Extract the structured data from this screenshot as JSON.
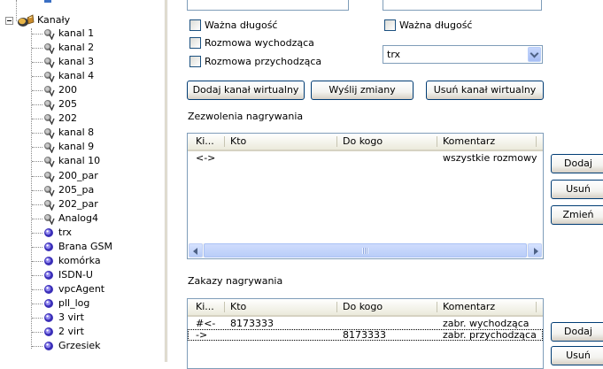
{
  "tree": {
    "partial_top_label": "",
    "root_label": "Kanały",
    "items": [
      {
        "label": "kanal 1",
        "icon": "channel-v-icon"
      },
      {
        "label": "kanal 2",
        "icon": "channel-v-icon"
      },
      {
        "label": "kanal 3",
        "icon": "channel-v-icon"
      },
      {
        "label": "kanal 4",
        "icon": "channel-v-icon"
      },
      {
        "label": "200",
        "icon": "channel-v-icon"
      },
      {
        "label": "205",
        "icon": "channel-v-icon"
      },
      {
        "label": "202",
        "icon": "channel-v-icon"
      },
      {
        "label": "kanal 8",
        "icon": "channel-v-icon"
      },
      {
        "label": "kanal 9",
        "icon": "channel-v-icon"
      },
      {
        "label": "kanal 10",
        "icon": "channel-v-icon"
      },
      {
        "label": "200_par",
        "icon": "channel-v-icon"
      },
      {
        "label": "205_pa",
        "icon": "channel-v-icon"
      },
      {
        "label": "202_par",
        "icon": "channel-v-icon"
      },
      {
        "label": "Analog4",
        "icon": "channel-v-icon"
      },
      {
        "label": "trx",
        "icon": "channel-icon"
      },
      {
        "label": "Brana GSM",
        "icon": "channel-icon"
      },
      {
        "label": "komórka",
        "icon": "channel-icon"
      },
      {
        "label": "ISDN-U",
        "icon": "channel-icon"
      },
      {
        "label": "vpcAgent",
        "icon": "channel-icon"
      },
      {
        "label": "pll_log",
        "icon": "channel-icon"
      },
      {
        "label": "3 virt",
        "icon": "channel-icon"
      },
      {
        "label": "2 virt",
        "icon": "channel-icon"
      },
      {
        "label": "Grzesiek",
        "icon": "channel-icon"
      }
    ]
  },
  "form": {
    "left_valid_length": "Ważna długość",
    "right_valid_length": "Ważna długość",
    "outgoing_call": "Rozmowa wychodząca",
    "incoming_call": "Rozmowa przychodząca",
    "channel_select_value": "trx"
  },
  "buttons": {
    "add_virtual": "Dodaj kanał wirtualny",
    "send_changes": "Wyślij zmiany",
    "remove_virtual": "Usuń kanał wirtualny",
    "perm_add": "Dodaj",
    "perm_remove": "Usuń",
    "perm_change": "Zmień",
    "ban_add": "Dodaj",
    "ban_remove": "Usuń"
  },
  "permissions": {
    "title": "Zezwolenia nagrywania",
    "columns": [
      "Ki...",
      "Kto",
      "Do kogo",
      "Komentarz"
    ],
    "rows": [
      [
        "<->",
        "",
        "",
        "wszystkie rozmowy"
      ]
    ]
  },
  "bans": {
    "title": "Zakazy nagrywania",
    "columns": [
      "Ki...",
      "Kto",
      "Do kogo",
      "Komentarz"
    ],
    "rows": [
      [
        "#<-",
        "8173333",
        "",
        "zabr. wychodząca"
      ],
      [
        "->",
        "",
        "8173333",
        "zabr. przychodząca"
      ]
    ]
  },
  "colors": {
    "list_border": "#7f9db9",
    "xp_button_border": "#003c74",
    "checkbox_border": "#1c5180"
  }
}
